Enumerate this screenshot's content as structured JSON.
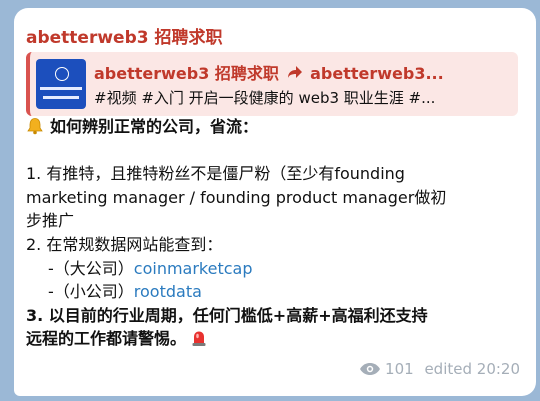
{
  "message": {
    "sender": "abetterweb3 招聘求职",
    "reply": {
      "title": "abetterweb3 招聘求职",
      "arrow_icon": "forward-arrow-icon",
      "target": "abetterweb3...",
      "text": "#视频 #入门 开启一段健康的 web3 职业生涯 #...",
      "thumbnail_icon": "channel-thumbnail"
    },
    "heading": "如何辨别正常的公司，省流：",
    "point1_line1": "1. 有推特，且推特粉丝不是僵尸粉（至少有founding",
    "point1_line2": "marketing manager / founding product manager做初",
    "point1_line3": "步推广",
    "point2": "2. 在常规数据网站能查到：",
    "sub1_prefix": "-（大公司）",
    "sub1_link": "coinmarketcap",
    "sub2_prefix": "-（小公司）",
    "sub2_link": "rootdata",
    "point3_line1": "3. 以目前的行业周期，任何门槛低+高薪+高福利还支持",
    "point3_line2": "远程的工作都请警惕。",
    "views": "101",
    "edited": "edited 20:20",
    "colors": {
      "accent": "#c0392b",
      "link": "#2b7bbf",
      "meta": "#a5aeb8"
    }
  }
}
